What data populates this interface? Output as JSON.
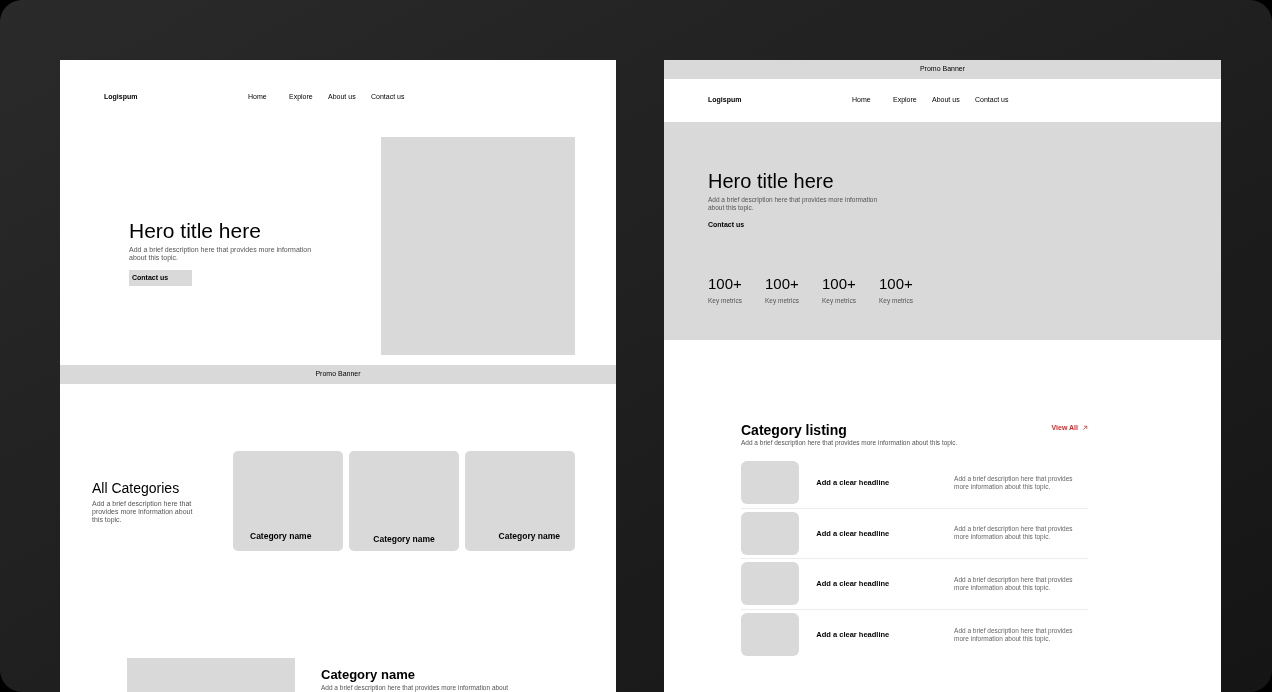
{
  "left_page": {
    "logo": "Logispum",
    "nav": [
      "Home",
      "Explore",
      "About us",
      "Contact us"
    ],
    "hero": {
      "title": "Hero title here",
      "description": "Add a brief description here that provides more information about this topic.",
      "button": "Contact us"
    },
    "promo_banner": "Promo Banner",
    "categories": {
      "title": "All Categories",
      "description": "Add a brief description here that provides more information about this topic.",
      "cards": [
        {
          "name": "Category name"
        },
        {
          "name": "Category name"
        },
        {
          "name": "Category name"
        }
      ]
    },
    "feature": {
      "title": "Category name",
      "description": "Add a brief description here that provides more information about"
    }
  },
  "right_page": {
    "promo_banner": "Promo Banner",
    "logo": "Logispum",
    "nav": [
      "Home",
      "Explore",
      "About us",
      "Contact us"
    ],
    "hero": {
      "title": "Hero title here",
      "description": "Add a brief description here that provides more information about this topic.",
      "link": "Contact us",
      "metrics": [
        {
          "value": "100+",
          "label": "Key metrics"
        },
        {
          "value": "100+",
          "label": "Key metrics"
        },
        {
          "value": "100+",
          "label": "Key metrics"
        },
        {
          "value": "100+",
          "label": "Key metrics"
        }
      ]
    },
    "listing": {
      "title": "Category listing",
      "description": "Add a brief description here that provides more information about this topic.",
      "view_all": "View All",
      "items": [
        {
          "headline": "Add a clear headline",
          "description": "Add a brief description here that provides more information about this topic."
        },
        {
          "headline": "Add a clear headline",
          "description": "Add a brief description here that provides more information about this topic."
        },
        {
          "headline": "Add a clear headline",
          "description": "Add a brief description here that provides more information about this topic."
        },
        {
          "headline": "Add a clear headline",
          "description": "Add a brief description here that provides more information about this topic."
        }
      ]
    }
  }
}
